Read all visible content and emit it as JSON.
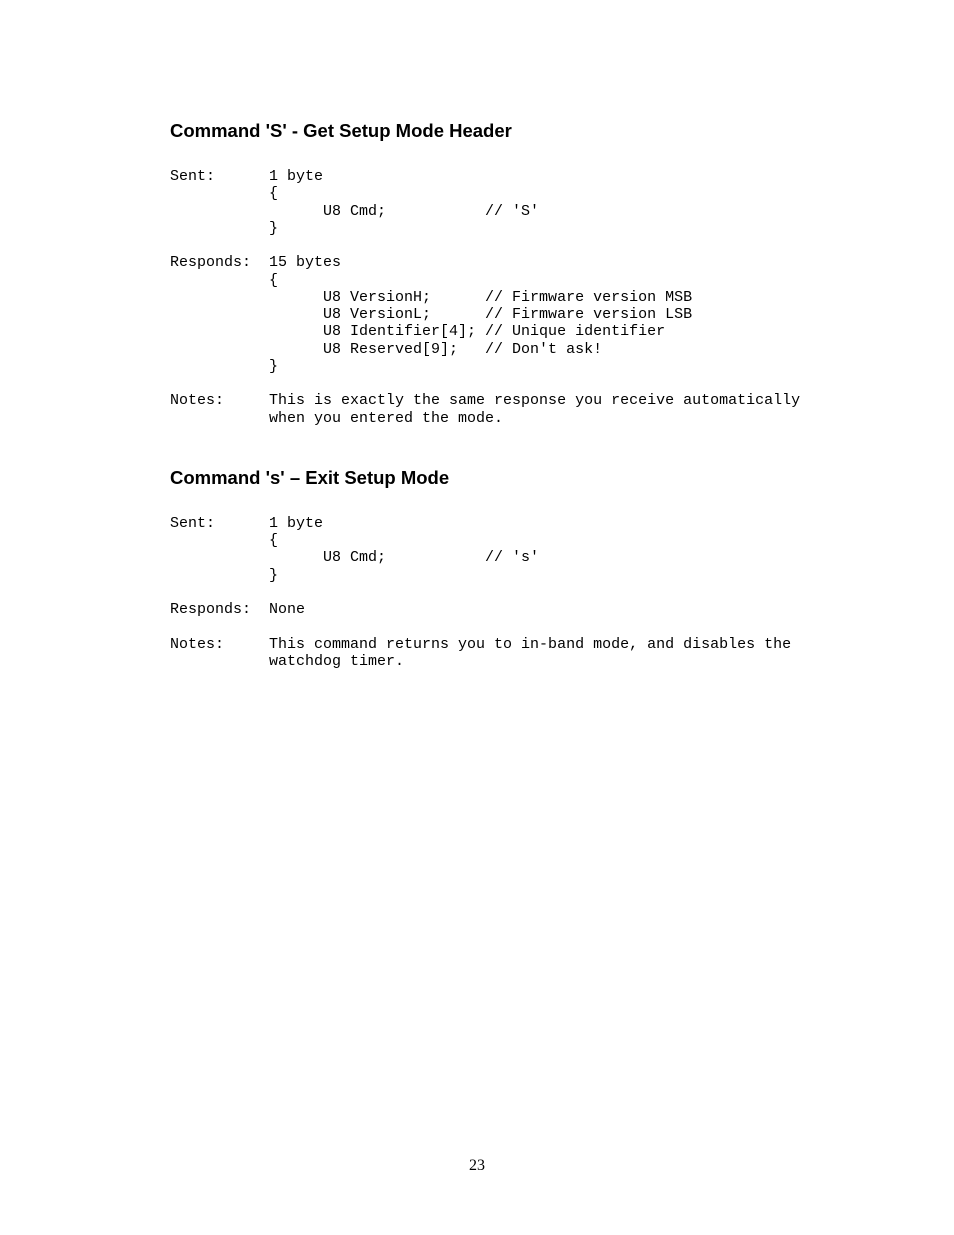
{
  "section1": {
    "heading": "Command 'S' - Get Setup Mode Header",
    "code": "Sent:      1 byte\n           {\n                 U8 Cmd;           // 'S'\n           }\n\nResponds:  15 bytes\n           {\n                 U8 VersionH;      // Firmware version MSB\n                 U8 VersionL;      // Firmware version LSB\n                 U8 Identifier[4]; // Unique identifier\n                 U8 Reserved[9];   // Don't ask!\n           }\n\nNotes:     This is exactly the same response you receive automatically\n           when you entered the mode."
  },
  "section2": {
    "heading": "Command 's' – Exit Setup Mode",
    "code": "Sent:      1 byte\n           {\n                 U8 Cmd;           // 's'\n           }\n\nResponds:  None\n\nNotes:     This command returns you to in-band mode, and disables the\n           watchdog timer."
  },
  "page_number": "23"
}
